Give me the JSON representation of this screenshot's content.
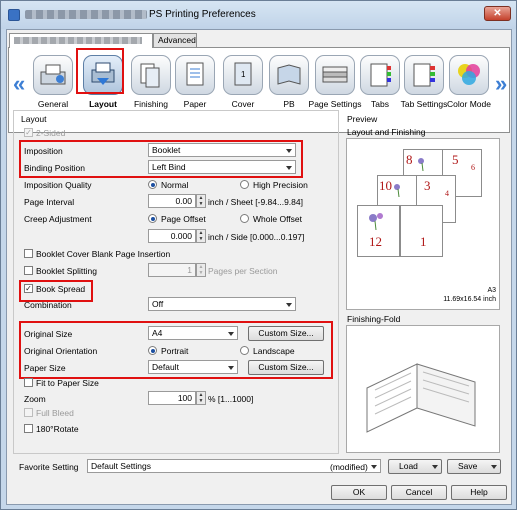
{
  "window": {
    "title": "PS Printing Preferences",
    "close": "✕"
  },
  "tabs": {
    "advanced": "Advanced"
  },
  "toolbar": {
    "items": [
      "General",
      "Layout",
      "Finishing",
      "Paper",
      "Cover",
      "PB",
      "Page Settings",
      "Tabs",
      "Tab Settings",
      "Color Mode"
    ],
    "selected": "Layout"
  },
  "layout": {
    "group": "Layout",
    "two_sided": "2-Sided",
    "imposition_label": "Imposition",
    "imposition_value": "Booklet",
    "binding_label": "Binding Position",
    "binding_value": "Left Bind",
    "quality_label": "Imposition Quality",
    "quality_normal": "Normal",
    "quality_high": "High Precision",
    "interval_label": "Page Interval",
    "interval_value": "0.00",
    "interval_unit": "inch / Sheet [-9.84...9.84]",
    "creep_label": "Creep Adjustment",
    "creep_page_offset": "Page Offset",
    "creep_whole_offset": "Whole Offset",
    "creep_value": "0.000",
    "creep_unit": "inch / Side [0.000...0.197]",
    "blank_insertion": "Booklet Cover Blank Page Insertion",
    "splitting": "Booklet Splitting",
    "split_value": "1",
    "split_unit": "Pages per Section",
    "book_spread": "Book Spread",
    "combination_label": "Combination",
    "combination_value": "Off",
    "original_size_label": "Original Size",
    "original_size_value": "A4",
    "custom_size_1": "Custom Size...",
    "orientation_label": "Original Orientation",
    "orientation_portrait": "Portrait",
    "orientation_landscape": "Landscape",
    "paper_size_label": "Paper Size",
    "paper_size_value": "Default",
    "custom_size_2": "Custom Size...",
    "fit_to_paper": "Fit to Paper Size",
    "zoom_label": "Zoom",
    "zoom_value": "100",
    "zoom_unit": "% [1...1000]",
    "full_bleed": "Full Bleed",
    "rotate": "180°Rotate"
  },
  "preview": {
    "group": "Preview",
    "layout_finishing": "Layout and Finishing",
    "finishing_fold": "Finishing-Fold",
    "paper": "A3",
    "paper_dim": "11.69x16.54 inch",
    "pages": [
      "8",
      "5",
      "6",
      "10",
      "3",
      "4",
      "12",
      "1"
    ]
  },
  "favorite": {
    "label": "Favorite Setting",
    "value": "Default Settings",
    "modified": "(modified)",
    "load": "Load",
    "save": "Save"
  },
  "buttons": {
    "ok": "OK",
    "cancel": "Cancel",
    "help": "Help"
  }
}
